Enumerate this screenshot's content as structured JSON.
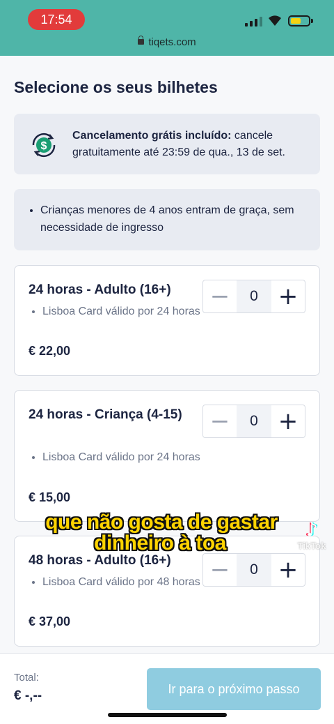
{
  "status_bar": {
    "time": "17:54",
    "url": "tiqets.com",
    "colors": {
      "bar": "#4fb5a8",
      "time_pill": "#e23b3b",
      "battery": "#f5d211"
    }
  },
  "page": {
    "title": "Selecione os seus bilhetes"
  },
  "cancellation": {
    "icon": "dollar-refresh-icon",
    "bold": "Cancelamento grátis incluído:",
    "text": " cancele gratuitamente até 23:59 de qua., 13 de set."
  },
  "kids_info": {
    "items": [
      "Crianças menores de 4 anos entram de graça, sem necessidade de ingresso"
    ]
  },
  "tickets": [
    {
      "name": "24 horas - Adulto (16+)",
      "detail": "Lisboa Card válido por 24 horas",
      "price": "€ 22,00",
      "quantity": "0"
    },
    {
      "name": "24 horas - Criança (4-15)",
      "detail": "Lisboa Card válido por 24 horas",
      "price": "€ 15,00",
      "quantity": "0"
    },
    {
      "name": "48 horas - Adulto (16+)",
      "detail": "Lisboa Card válido por 48 horas",
      "price": "€ 37,00",
      "quantity": "0"
    }
  ],
  "stepper": {
    "minus": "−",
    "plus": "+"
  },
  "footer": {
    "total_label": "Total:",
    "total_value": "€ -,--",
    "next_button": "Ir para o próximo passo",
    "button_color": "#8fcce0"
  },
  "overlay": {
    "caption_line1": "que não gosta de gastar",
    "caption_line2": "dinheiro à toa",
    "watermark": "TikTok",
    "watermark_icon": "tiktok-logo-icon"
  }
}
